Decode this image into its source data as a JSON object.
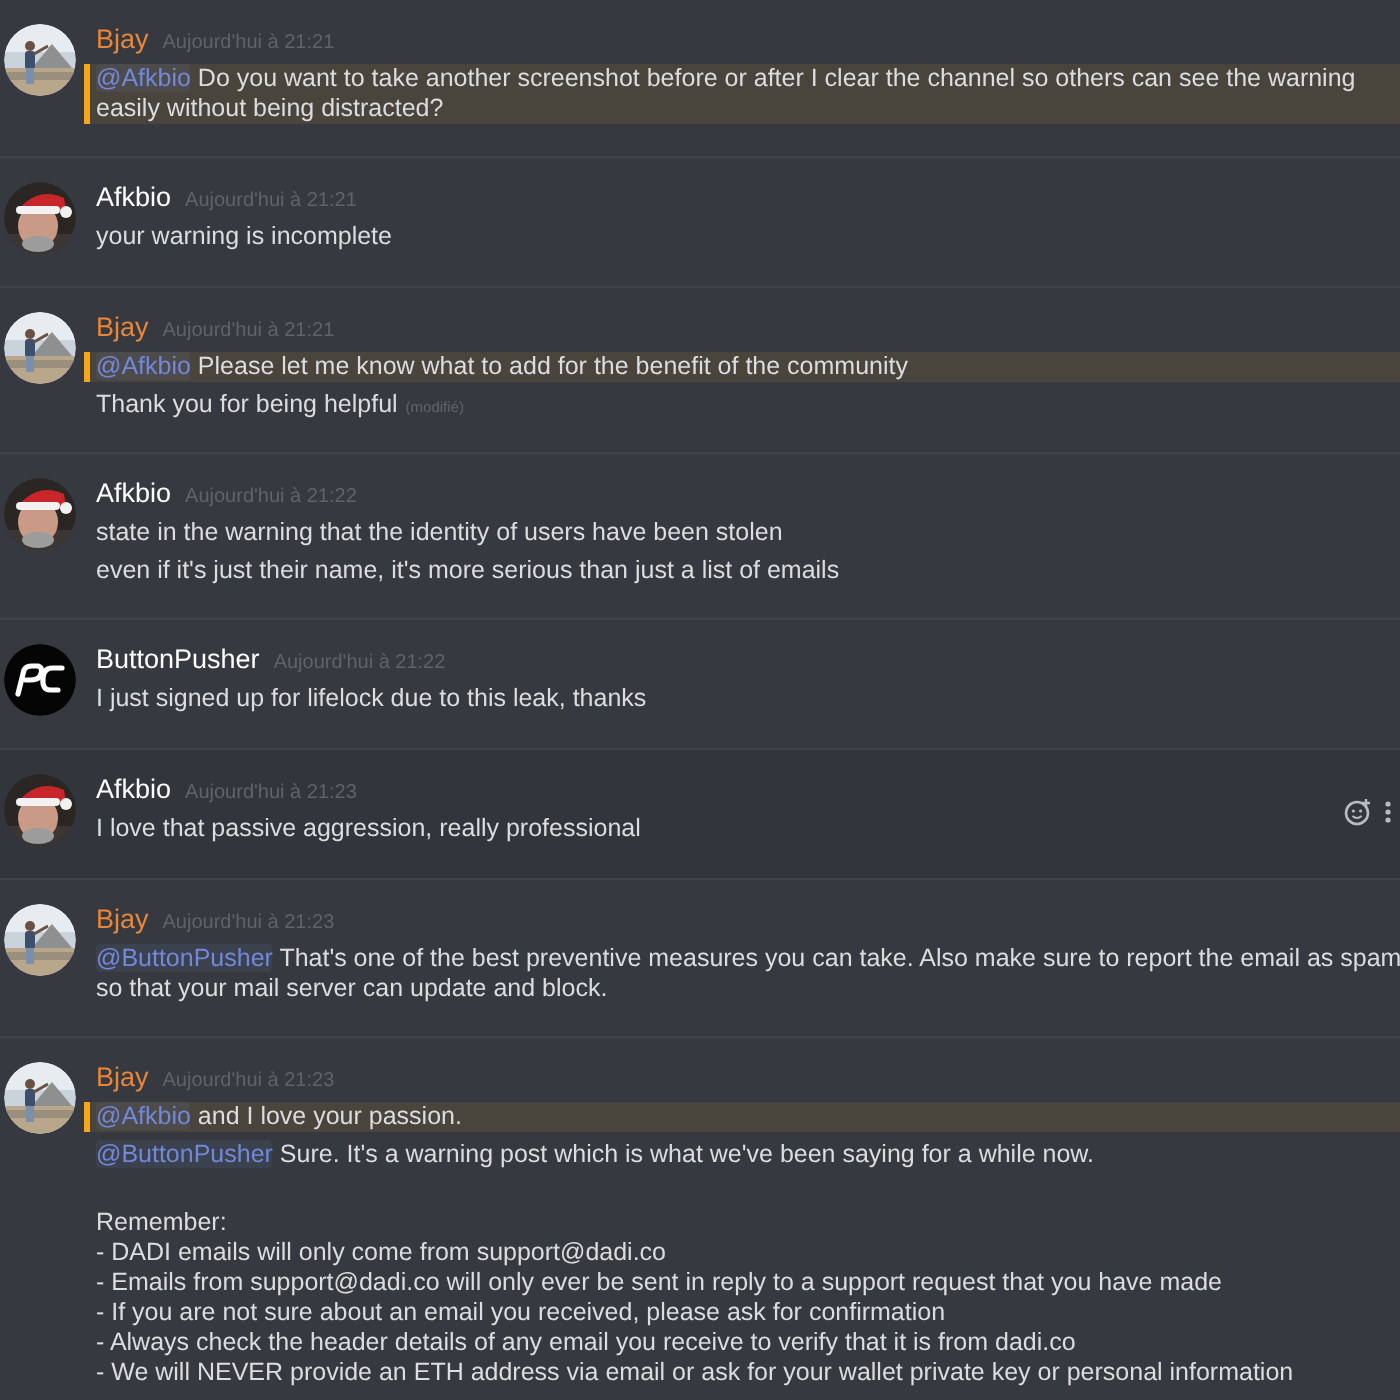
{
  "messages": [
    {
      "author": "Bjay",
      "color": "#e8863a",
      "avatar": {
        "kind": "outdoor_picture"
      },
      "timestamp": "Aujourd'hui à 21:21",
      "hovered": false,
      "paragraphs": [
        {
          "highlighted": true,
          "mention": "@Afkbio",
          "lines": [
            "Do you want to take another screenshot before or after I clear the channel so others can see the warning",
            "easily without being distracted?"
          ]
        }
      ]
    },
    {
      "author": "Afkbio",
      "color": "#ffffff",
      "avatar": {
        "kind": "hat_picture"
      },
      "timestamp": "Aujourd'hui à 21:21",
      "hovered": false,
      "paragraphs": [
        {
          "highlighted": false,
          "lines": [
            "your warning is incomplete"
          ]
        }
      ]
    },
    {
      "author": "Bjay",
      "color": "#e8863a",
      "avatar": {
        "kind": "outdoor_picture"
      },
      "timestamp": "Aujourd'hui à 21:21",
      "hovered": false,
      "paragraphs": [
        {
          "highlighted": true,
          "mention": "@Afkbio",
          "lines": [
            "Please let me know what to add for the benefit of the community"
          ]
        },
        {
          "highlighted": false,
          "lines": [
            "Thank you for being helpful"
          ],
          "edited": "(modifié)"
        }
      ]
    },
    {
      "author": "Afkbio",
      "color": "#ffffff",
      "avatar": {
        "kind": "hat_picture"
      },
      "timestamp": "Aujourd'hui à 21:22",
      "hovered": false,
      "paragraphs": [
        {
          "highlighted": false,
          "lines": [
            "state in the warning that the identity of users have been stolen"
          ]
        },
        {
          "highlighted": false,
          "lines": [
            "even if it's just their name, it's more serious than just a list of emails"
          ]
        }
      ]
    },
    {
      "author": "ButtonPusher",
      "color": "#ffffff",
      "avatar": {
        "kind": "logo"
      },
      "timestamp": "Aujourd'hui à 21:22",
      "hovered": false,
      "paragraphs": [
        {
          "highlighted": false,
          "lines": [
            "I just signed up for lifelock due to this leak, thanks"
          ]
        }
      ]
    },
    {
      "author": "Afkbio",
      "color": "#ffffff",
      "avatar": {
        "kind": "hat_picture"
      },
      "timestamp": "Aujourd'hui à 21:23",
      "hovered": true,
      "paragraphs": [
        {
          "highlighted": false,
          "lines": [
            "I love that passive aggression, really professional"
          ]
        }
      ]
    },
    {
      "author": "Bjay",
      "color": "#e8863a",
      "avatar": {
        "kind": "outdoor_picture"
      },
      "timestamp": "Aujourd'hui à 21:23",
      "hovered": false,
      "paragraphs": [
        {
          "highlighted": false,
          "mention": "@ButtonPusher",
          "lines": [
            "That's one of the best preventive measures you can take. Also make sure to report the email as spam",
            "so that your mail server can update and block."
          ]
        }
      ]
    },
    {
      "author": "Bjay",
      "color": "#e8863a",
      "avatar": {
        "kind": "outdoor_picture"
      },
      "timestamp": "Aujourd'hui à 21:23",
      "hovered": false,
      "paragraphs": [
        {
          "kind": "line",
          "highlighted": true,
          "mention": "@Afkbio",
          "lines": [
            "and I love your passion."
          ]
        },
        {
          "kind": "line",
          "highlighted": false,
          "mention": "@ButtonPusher",
          "lines": [
            "Sure. It's a warning post which is what we've been saying for a while now."
          ]
        },
        {
          "kind": "block",
          "highlighted": false,
          "lines": [
            "Remember:",
            "- DADI emails will only come from support@dadi.co",
            "- Emails from support@dadi.co will only ever be sent in reply to a support request that you have made",
            "- If you are not sure about an email you received, please ask for confirmation",
            "- Always check the header details of any email you receive to verify that it is from dadi.co",
            "- We will NEVER provide an ETH address via email or ask for your wallet private key or personal information"
          ]
        }
      ]
    }
  ]
}
